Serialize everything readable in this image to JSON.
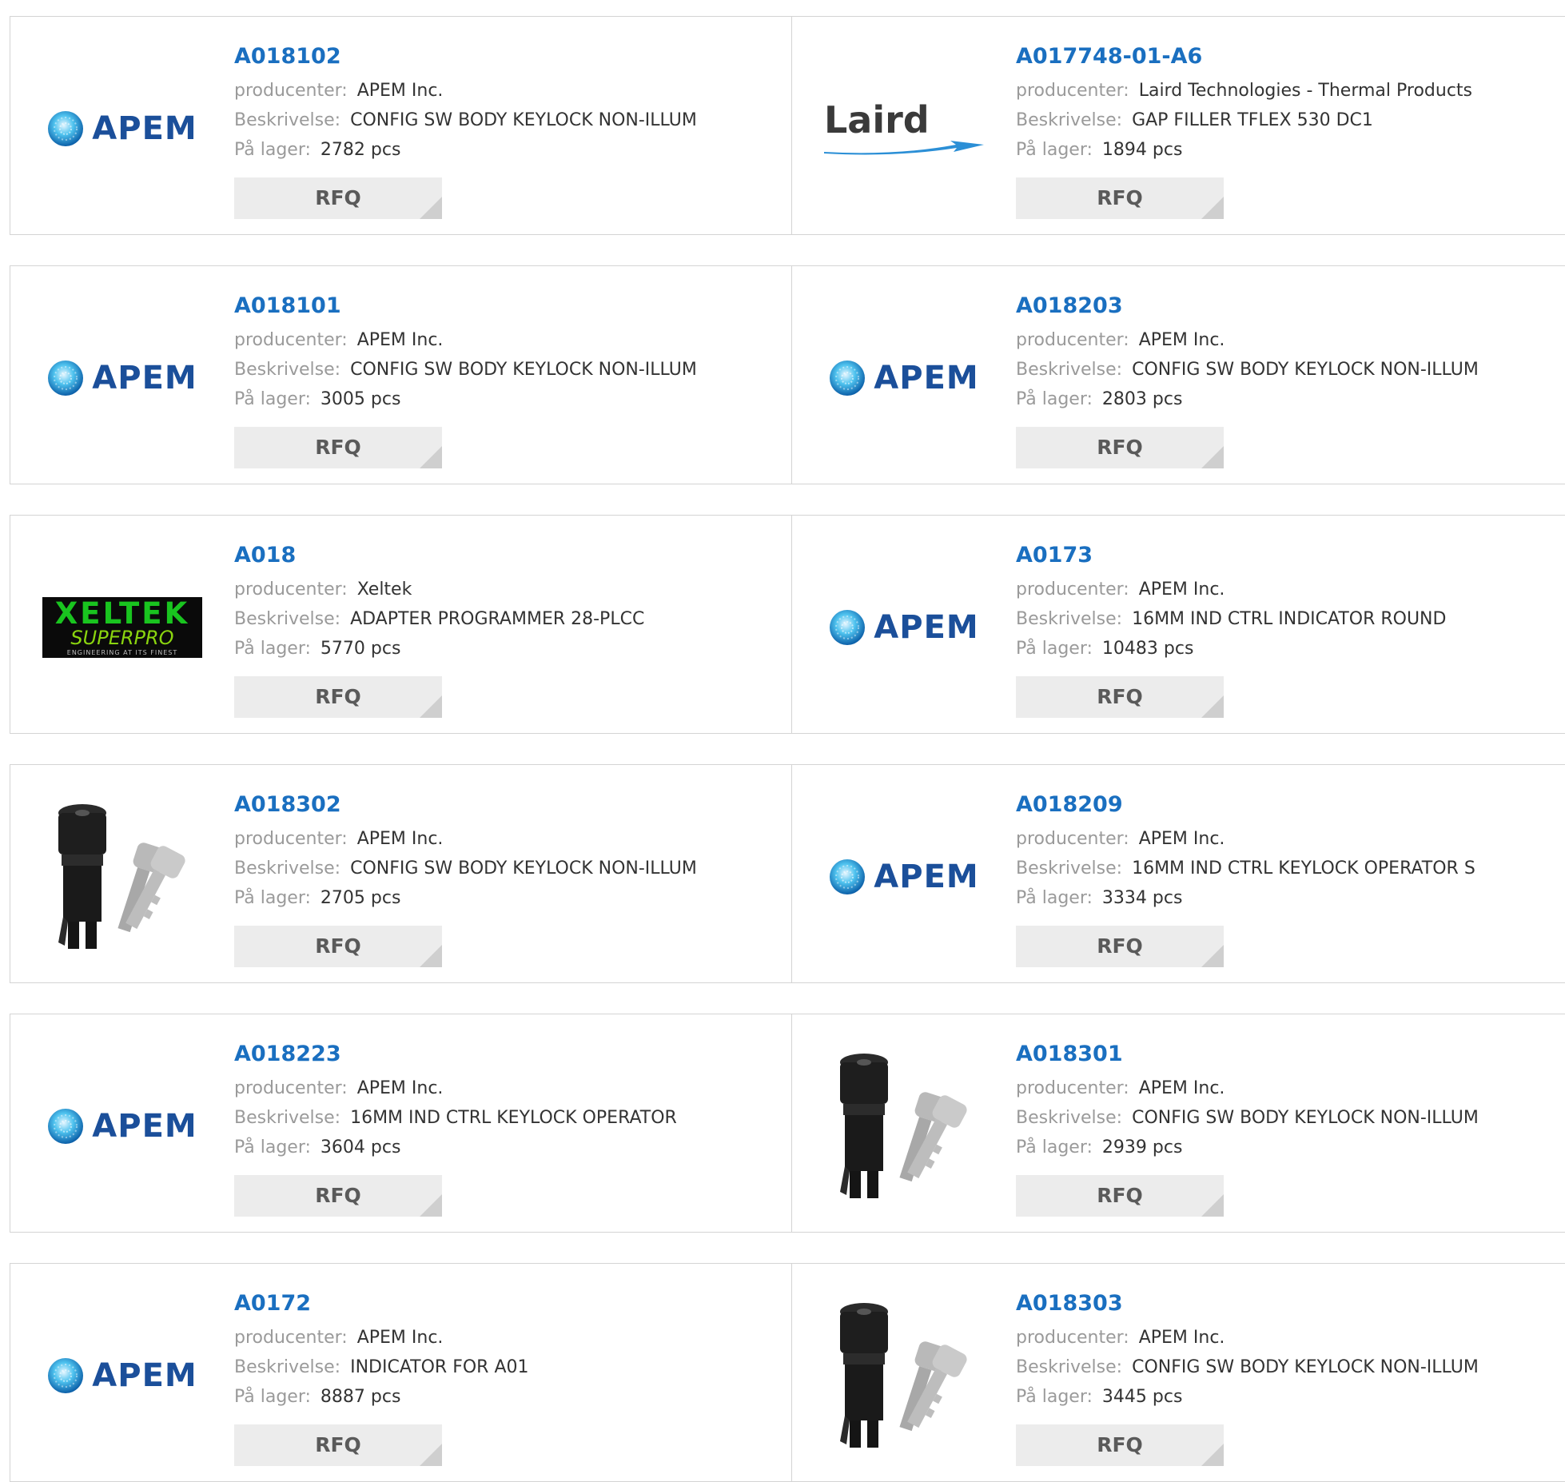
{
  "labels": {
    "manufacturer": "producenter:",
    "description": "Beskrivelse:",
    "stock": "På lager:",
    "rfq": "RFQ"
  },
  "logos": {
    "apem": "APEM",
    "laird": "Laird",
    "xeltek_1": "XELTEK",
    "xeltek_2": "SUPERPRO",
    "xeltek_3": "ENGINEERING AT ITS FINEST"
  },
  "colors": {
    "link": "#1a6fc0",
    "label": "#9a9a9a",
    "value": "#333333",
    "rfq_bg": "#ececec"
  },
  "products": [
    {
      "part_number": "A018102",
      "manufacturer": "APEM Inc.",
      "description": "CONFIG SW BODY KEYLOCK NON-ILLUM",
      "stock": "2782 pcs",
      "image": "apem-logo"
    },
    {
      "part_number": "A017748-01-A6",
      "manufacturer": "Laird Technologies - Thermal Products",
      "description": "GAP FILLER TFLEX 530 DC1",
      "stock": "1894 pcs",
      "image": "laird-logo"
    },
    {
      "part_number": "A018101",
      "manufacturer": "APEM Inc.",
      "description": "CONFIG SW BODY KEYLOCK NON-ILLUM",
      "stock": "3005 pcs",
      "image": "apem-logo"
    },
    {
      "part_number": "A018203",
      "manufacturer": "APEM Inc.",
      "description": "CONFIG SW BODY KEYLOCK NON-ILLUM",
      "stock": "2803 pcs",
      "image": "apem-logo"
    },
    {
      "part_number": "A018",
      "manufacturer": "Xeltek",
      "description": "ADAPTER PROGRAMMER 28-PLCC",
      "stock": "5770 pcs",
      "image": "xeltek-logo"
    },
    {
      "part_number": "A0173",
      "manufacturer": "APEM Inc.",
      "description": "16MM IND CTRL INDICATOR ROUND",
      "stock": "10483 pcs",
      "image": "apem-logo"
    },
    {
      "part_number": "A018302",
      "manufacturer": "APEM Inc.",
      "description": "CONFIG SW BODY KEYLOCK NON-ILLUM",
      "stock": "2705 pcs",
      "image": "keylock-photo"
    },
    {
      "part_number": "A018209",
      "manufacturer": "APEM Inc.",
      "description": "16MM IND CTRL KEYLOCK OPERATOR S",
      "stock": "3334 pcs",
      "image": "apem-logo"
    },
    {
      "part_number": "A018223",
      "manufacturer": "APEM Inc.",
      "description": "16MM IND CTRL KEYLOCK OPERATOR",
      "stock": "3604 pcs",
      "image": "apem-logo"
    },
    {
      "part_number": "A018301",
      "manufacturer": "APEM Inc.",
      "description": "CONFIG SW BODY KEYLOCK NON-ILLUM",
      "stock": "2939 pcs",
      "image": "keylock-photo"
    },
    {
      "part_number": "A0172",
      "manufacturer": "APEM Inc.",
      "description": "INDICATOR FOR A01",
      "stock": "8887 pcs",
      "image": "apem-logo"
    },
    {
      "part_number": "A018303",
      "manufacturer": "APEM Inc.",
      "description": "CONFIG SW BODY KEYLOCK NON-ILLUM",
      "stock": "3445 pcs",
      "image": "keylock-photo"
    }
  ]
}
